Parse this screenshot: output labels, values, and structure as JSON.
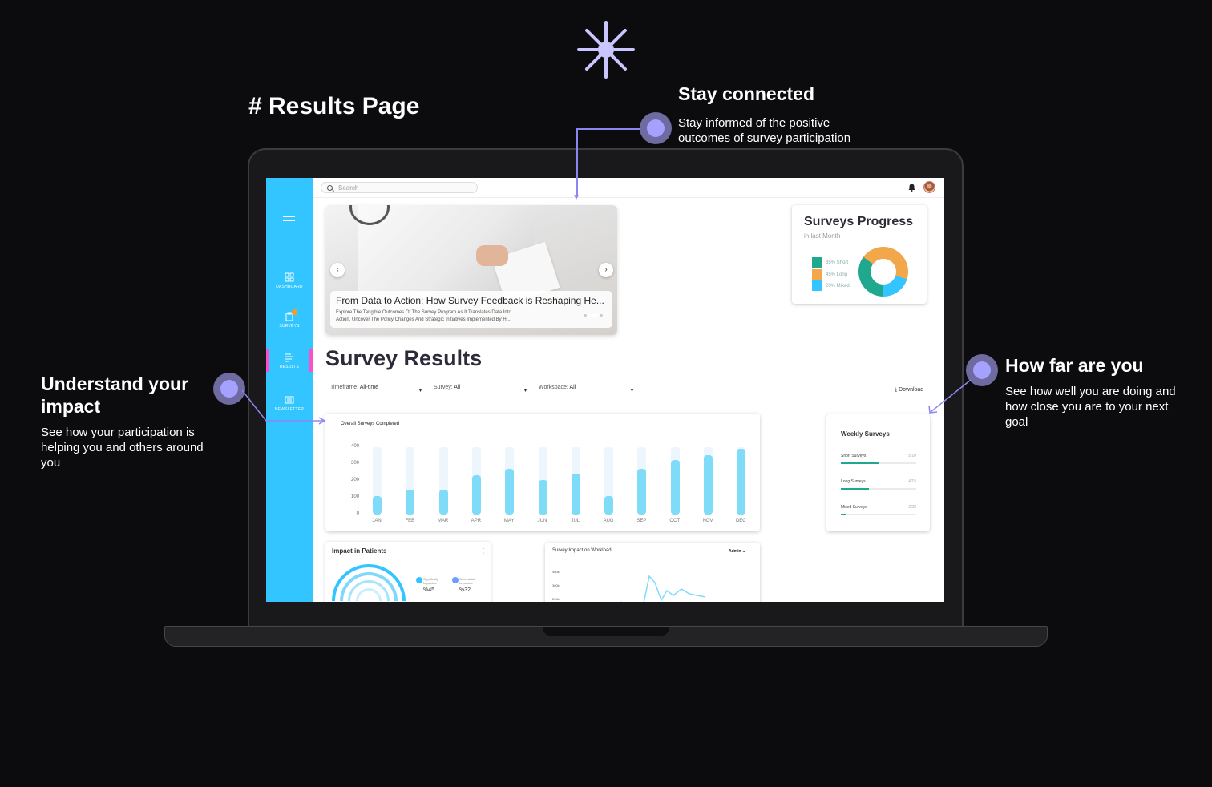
{
  "page_heading": "# Results Page",
  "callouts": {
    "connected": {
      "title": "Stay connected",
      "body_line1": "Stay informed of the positive",
      "body_line2": "outcomes of survey participation"
    },
    "impact": {
      "title_line1": "Understand your",
      "title_line2": "impact",
      "body_line1": "See how your participation is",
      "body_line2": "helping you and others around",
      "body_line3": "you"
    },
    "far": {
      "title": "How far are you",
      "body_line1": "See how well you are doing and",
      "body_line2": "how close you are to your next",
      "body_line3": "goal"
    }
  },
  "app": {
    "search_placeholder": "Search",
    "nav": [
      {
        "label": "DASHBOARD",
        "icon": "grid-icon"
      },
      {
        "label": "SURVEYS",
        "icon": "clipboard-icon"
      },
      {
        "label": "RESULTS",
        "icon": "results-icon"
      },
      {
        "label": "NEWSLETTER",
        "icon": "newsletter-icon"
      }
    ],
    "hero": {
      "title": "From Data to Action: How Survey Feedback is Reshaping He...",
      "desc_line1": "Explore The Tangible Outcomes Of The Survey Program As It Translates Data Into",
      "desc_line2": "Action. Uncover The Policy Changes And Strategic Initiatives Implemented By H..."
    },
    "progress": {
      "title": "Surveys Progress",
      "subtitle": "in last Month",
      "legend": [
        {
          "label": "35% Short",
          "color": "#1fa88e",
          "value": 35
        },
        {
          "label": "45% Long",
          "color": "#f2a74a",
          "value": 45
        },
        {
          "label": "20% Mixed",
          "color": "#33c5ff",
          "value": 20
        }
      ]
    },
    "survey_results_title": "Survey Results",
    "filters": {
      "timeframe_label": "Timeframe:",
      "timeframe_value": "All-time",
      "survey_label": "Survey:",
      "survey_value": "All",
      "workspace_label": "Workspace:",
      "workspace_value": "All"
    },
    "download_label": "Download",
    "weekly": {
      "title": "Weekly Surveys",
      "rows": [
        {
          "label": "Short Surveys",
          "count": "5/10",
          "fraction": 0.5
        },
        {
          "label": "Long Surveys",
          "count": "4/15",
          "fraction": 0.37
        },
        {
          "label": "Mixed Surveys",
          "count": "2/20",
          "fraction": 0.07
        }
      ]
    },
    "impact": {
      "title": "Impact in Patients",
      "sig_line1": "Significally",
      "sig_line2": "Impacted",
      "sig_value": "%45",
      "some_line1": "Somewhat",
      "some_line2": "Impacted",
      "some_value": "%32"
    },
    "workload": {
      "title": "Survey Impact on Workload",
      "filter": "Admin",
      "yticks": [
        "400k",
        "300k",
        "200k"
      ]
    }
  },
  "chart_data": {
    "type": "bar",
    "title": "Overall Surveys Completed",
    "categories": [
      "JAN",
      "FEB",
      "MAR",
      "APR",
      "MAY",
      "JUN",
      "JUL",
      "AUG",
      "SEP",
      "OCT",
      "NOV",
      "DEC"
    ],
    "values": [
      120,
      160,
      160,
      250,
      290,
      220,
      260,
      120,
      290,
      350,
      380,
      420
    ],
    "yticks": [
      "400",
      "300",
      "200",
      "100",
      "0"
    ],
    "ylim": [
      0,
      430
    ],
    "colors": {
      "fill": "#7fdcf9",
      "track": "#eef6fd"
    }
  }
}
